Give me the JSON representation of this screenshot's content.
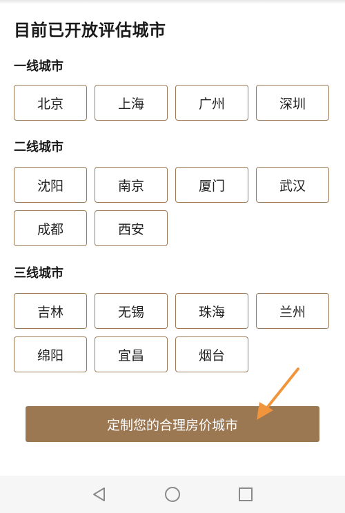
{
  "page_title": "目前已开放评估城市",
  "sections": [
    {
      "title": "一线城市",
      "cities": [
        "北京",
        "上海",
        "广州",
        "深圳"
      ]
    },
    {
      "title": "二线城市",
      "cities": [
        "沈阳",
        "南京",
        "厦门",
        "武汉",
        "成都",
        "西安"
      ]
    },
    {
      "title": "三线城市",
      "cities": [
        "吉林",
        "无锡",
        "珠海",
        "兰州",
        "绵阳",
        "宜昌",
        "烟台"
      ]
    }
  ],
  "cta_label": "定制您的合理房价城市",
  "colors": {
    "accent": "#9b7752",
    "button_border": "#9b7a55",
    "arrow": "#f0953b"
  },
  "nav_icons": [
    "back-icon",
    "home-icon",
    "recents-icon"
  ]
}
